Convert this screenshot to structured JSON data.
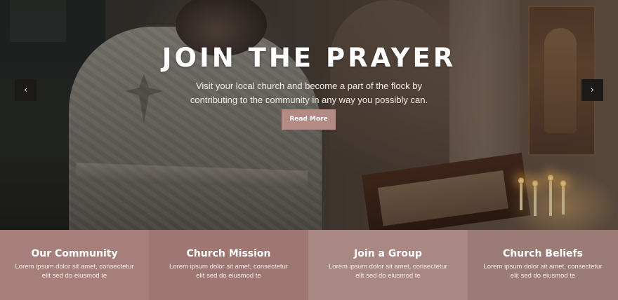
{
  "hero": {
    "title": "JOIN THE PRAYER",
    "subtitle_line1": "Visit your local church and become a part of the flock by",
    "subtitle_line2": "contributing to the community in any way you possibly can.",
    "read_more_label": "Read More",
    "prev_icon": "chevron-left-icon",
    "next_icon": "chevron-right-icon",
    "prev_glyph": "‹",
    "next_glyph": "›"
  },
  "features": [
    {
      "title": "Our Community",
      "text_line1": "Lorem ipsum dolor sit amet, consectetur",
      "text_line2": "elit sed do eiusmod te",
      "color": "#a77f7a"
    },
    {
      "title": "Church Mission",
      "text_line1": "Lorem ipsum dolor sit amet, consectetur",
      "text_line2": "elit sed do eiusmod te",
      "color": "#9e7772"
    },
    {
      "title": "Join a Group",
      "text_line1": "Lorem ipsum dolor sit amet, consectetur",
      "text_line2": "elit sed do eiusmod te",
      "color": "#a98783"
    },
    {
      "title": "Church Beliefs",
      "text_line1": "Lorem ipsum dolor sit amet, consectetur",
      "text_line2": "elit sed do eiusmod te",
      "color": "#9b7b76"
    }
  ],
  "colors": {
    "accent": "#b48a84",
    "arrow_bg": "#1b1a19",
    "text": "#ffffff"
  }
}
